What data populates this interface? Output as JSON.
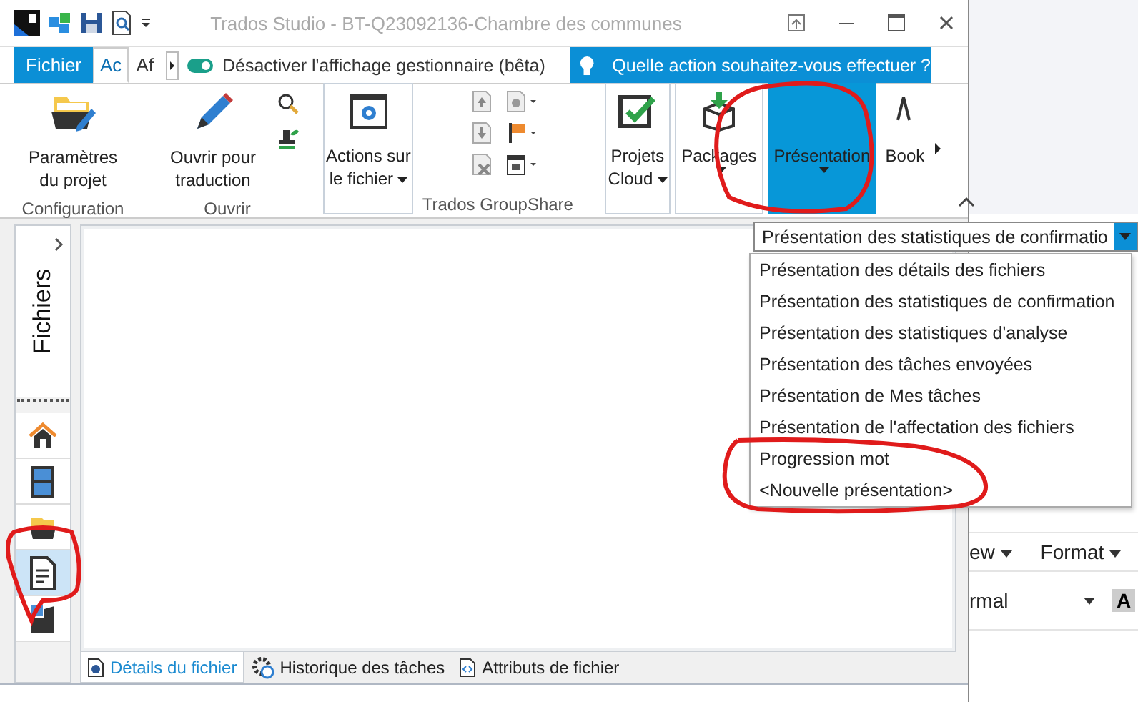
{
  "window": {
    "title": "Trados Studio - BT-Q23092136-Chambre des communes"
  },
  "ribbon_tabs": [
    {
      "label": "Fichier",
      "kind": "file",
      "selected": false
    },
    {
      "label": "Ac",
      "kind": "tab",
      "selected": true
    },
    {
      "label": "Af",
      "kind": "tab",
      "selected": false
    }
  ],
  "manager_toggle": {
    "label": "Désactiver l'affichage gestionnaire (bêta)",
    "on": true
  },
  "tell_me": {
    "placeholder": "Quelle action souhaitez-vous effectuer ?"
  },
  "ribbon": {
    "buttons": [
      {
        "lines": [
          "Paramètres",
          "du projet"
        ],
        "dropdown": false,
        "selected": false
      },
      {
        "lines": [
          "Ouvrir pour",
          "traduction"
        ],
        "dropdown": false,
        "selected": false
      },
      {
        "lines": [
          "Actions sur",
          "le fichier"
        ],
        "dropdown": true,
        "selected": false
      },
      {
        "lines": [
          "Projets",
          "Cloud"
        ],
        "dropdown": true,
        "selected": false
      },
      {
        "lines": [
          "Packages"
        ],
        "dropdown": true,
        "selected": false
      },
      {
        "lines": [
          "Présentation"
        ],
        "dropdown": true,
        "selected": true
      },
      {
        "lines": [
          "Book"
        ],
        "dropdown": false,
        "selected": false
      }
    ],
    "group_labels": [
      "Configuration",
      "Ouvrir",
      "Trados GroupShare"
    ]
  },
  "sidebar": {
    "title": "Fichiers",
    "items": [
      {
        "selected": false
      },
      {
        "selected": false
      },
      {
        "selected": false
      },
      {
        "selected": true
      },
      {
        "selected": false
      }
    ]
  },
  "layout_combo": {
    "value": "Présentation des statistiques de confirmatio"
  },
  "layout_options": [
    {
      "label": "Présentation des détails des fichiers"
    },
    {
      "label": "Présentation des statistiques de confirmation"
    },
    {
      "label": "Présentation des statistiques d'analyse"
    },
    {
      "label": "Présentation des tâches envoyées"
    },
    {
      "label": "Présentation de Mes tâches"
    },
    {
      "label": "Présentation de l'affectation des fichiers"
    },
    {
      "label": "Progression mot"
    },
    {
      "label": "<Nouvelle présentation>"
    }
  ],
  "bottom_tabs": [
    {
      "label": "Détails du fichier",
      "selected": true
    },
    {
      "label": "Historique des tâches",
      "selected": false
    },
    {
      "label": "Attributs de fichier",
      "selected": false
    }
  ],
  "background_window": {
    "menu": [
      "ew",
      "Format"
    ],
    "style_value": "rmal",
    "bold_key": "A"
  }
}
